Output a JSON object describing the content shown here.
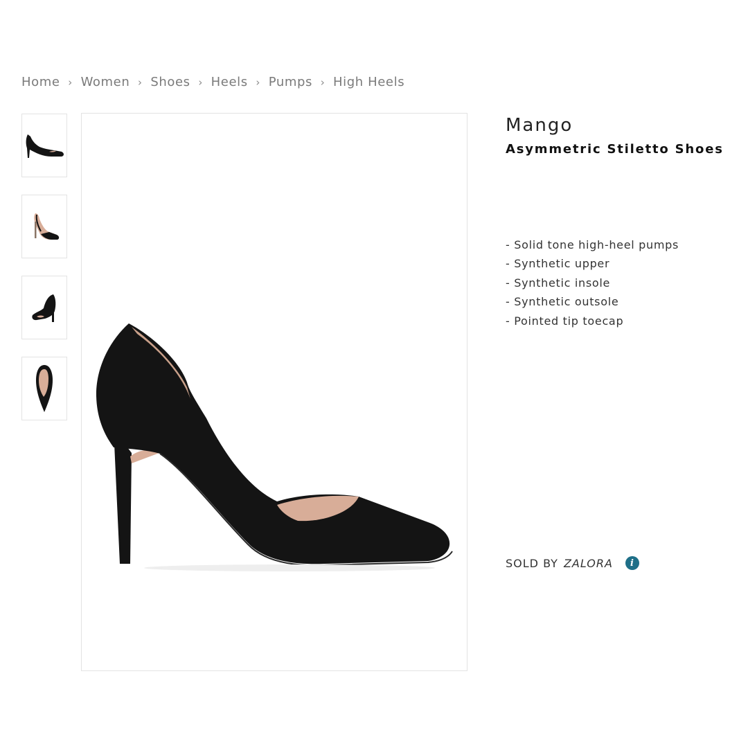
{
  "breadcrumb": {
    "items": [
      "Home",
      "Women",
      "Shoes",
      "Heels",
      "Pumps",
      "High Heels"
    ],
    "separator": "›"
  },
  "product": {
    "brand": "Mango",
    "name": "Asymmetric Stiletto Shoes",
    "features": [
      "- Solid tone high-heel pumps",
      "- Synthetic upper",
      "- Synthetic insole",
      "- Synthetic outsole",
      "- Pointed tip toecap"
    ],
    "sold_by_label": "SOLD BY",
    "seller": "ZALORA",
    "info_icon_glyph": "i"
  },
  "images": {
    "thumbnails": [
      "side-view",
      "front-three-quarter-view",
      "back-three-quarter-view",
      "top-view"
    ],
    "main": "side-view"
  },
  "colors": {
    "shoe": "#141414",
    "lining": "#d8ad98",
    "info_icon": "#1e6f88"
  }
}
